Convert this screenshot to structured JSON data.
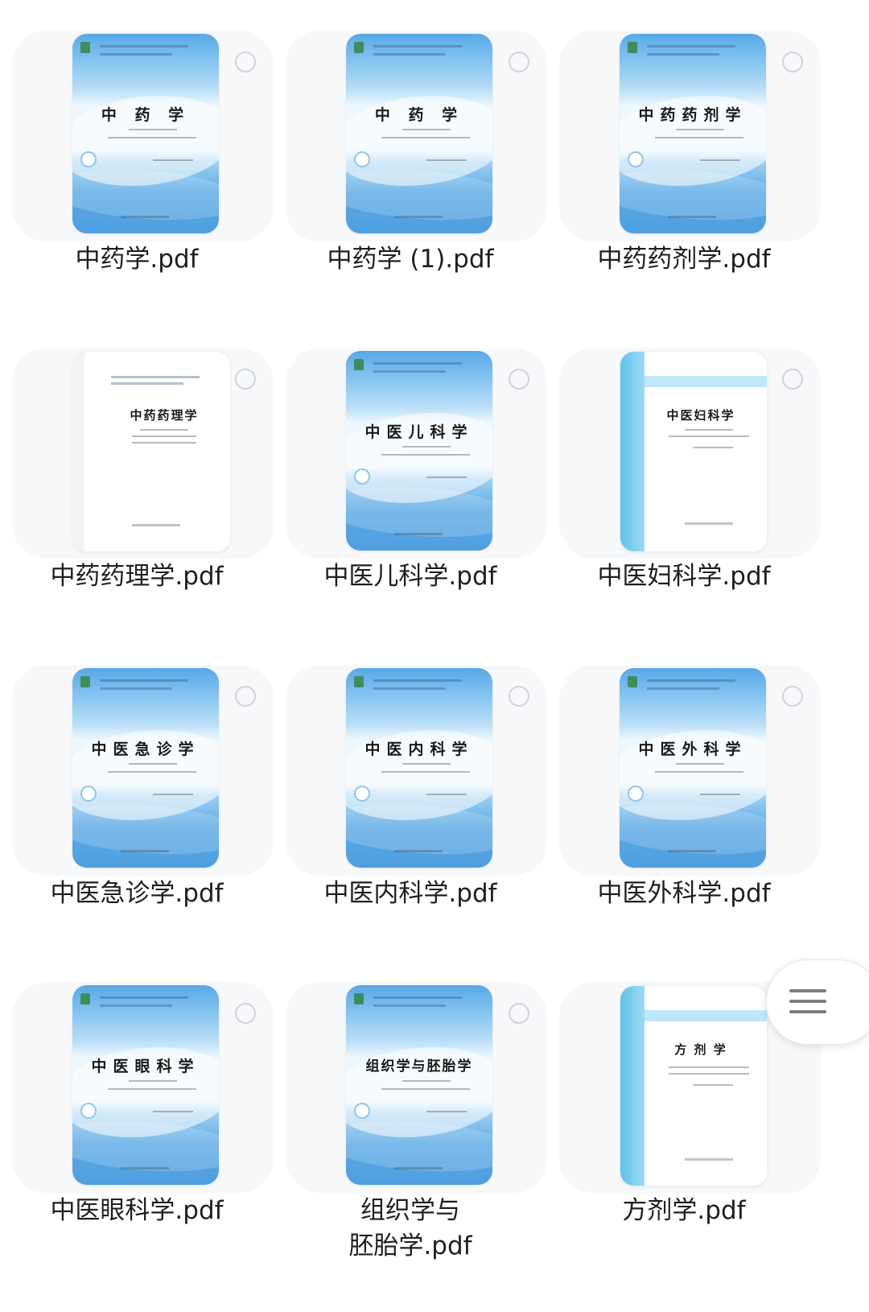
{
  "files": [
    {
      "name": "中药学.pdf",
      "cover_title": "中 药 学",
      "cover_style": "blue"
    },
    {
      "name": "中药学 (1).pdf",
      "cover_title": "中 药 学",
      "cover_style": "blue"
    },
    {
      "name": "中药药剂学.pdf",
      "cover_title": "中药药剂学",
      "cover_style": "blue"
    },
    {
      "name": "中药药理学.pdf",
      "cover_title": "中药药理学",
      "cover_style": "white-plain"
    },
    {
      "name": "中医儿科学.pdf",
      "cover_title": "中医儿科学",
      "cover_style": "blue"
    },
    {
      "name": "中医妇科学.pdf",
      "cover_title": "中医妇科学",
      "cover_style": "white"
    },
    {
      "name": "中医急诊学.pdf",
      "cover_title": "中医急诊学",
      "cover_style": "blue"
    },
    {
      "name": "中医内科学.pdf",
      "cover_title": "中医内科学",
      "cover_style": "blue"
    },
    {
      "name": "中医外科学.pdf",
      "cover_title": "中医外科学",
      "cover_style": "blue"
    },
    {
      "name": "中医眼科学.pdf",
      "cover_title": "中医眼科学",
      "cover_style": "blue"
    },
    {
      "name": "组织学与\n胚胎学.pdf",
      "cover_title": "组织学与胚胎学",
      "cover_style": "blue"
    },
    {
      "name": "方剂学.pdf",
      "cover_title": "方 剂 学",
      "cover_style": "white"
    }
  ],
  "floating_menu": {
    "icon": "menu-icon"
  },
  "colors": {
    "tile_background": "#f7f8fa",
    "selection_circle": "#d0d3d7",
    "cover_blue": "#5ba9e4",
    "cover_spine": "#5fc2ea"
  }
}
